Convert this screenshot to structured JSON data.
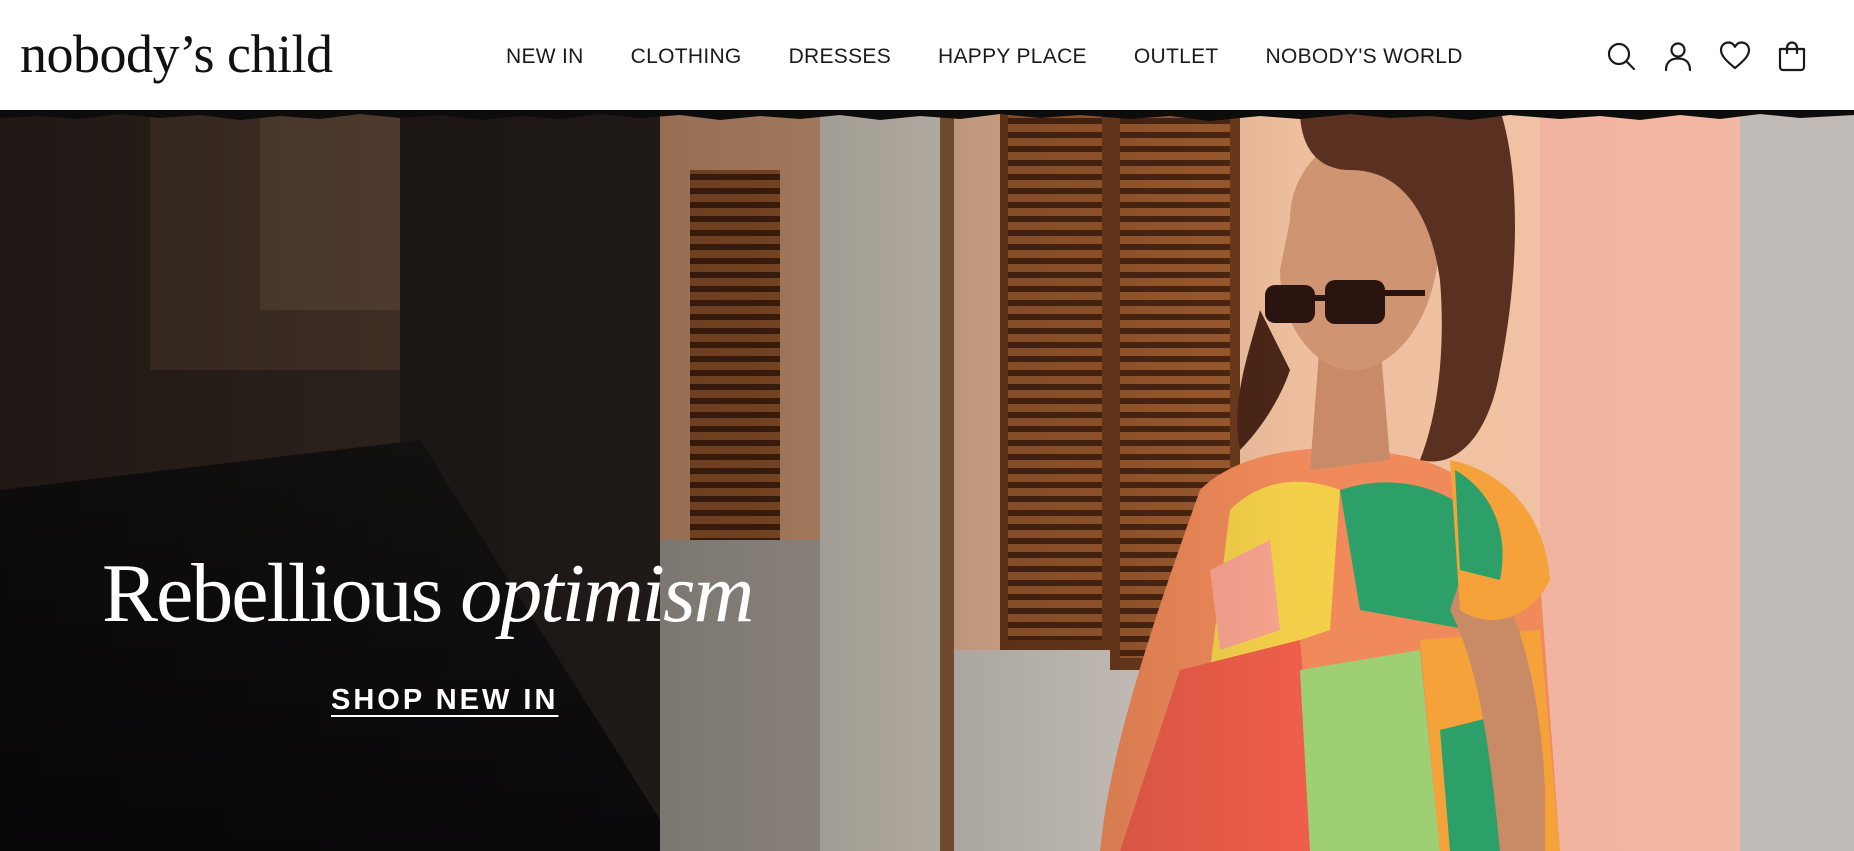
{
  "brand": {
    "logo_text": "nobody’s child"
  },
  "nav": {
    "items": [
      {
        "label": "NEW IN"
      },
      {
        "label": "CLOTHING"
      },
      {
        "label": "DRESSES"
      },
      {
        "label": "HAPPY PLACE"
      },
      {
        "label": "OUTLET"
      },
      {
        "label": "NOBODY'S WORLD"
      }
    ]
  },
  "utilities": {
    "icons": [
      "search-icon",
      "account-icon",
      "wishlist-heart-icon",
      "shopping-bag-icon"
    ]
  },
  "hero": {
    "title_plain": "Rebellious ",
    "title_italic": "optimism",
    "cta_label": "SHOP NEW IN"
  },
  "colors": {
    "header_bg": "#ffffff",
    "text_dark": "#1a1a1a",
    "hero_text": "#ffffff"
  }
}
